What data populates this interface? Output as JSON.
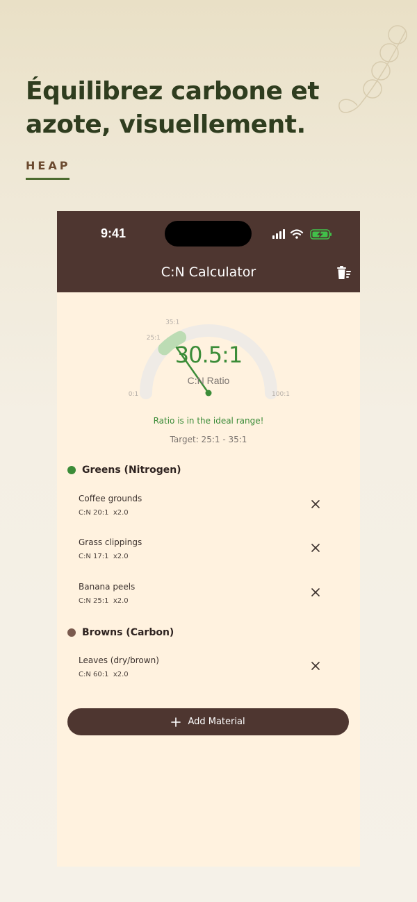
{
  "marketing": {
    "headline": "Équilibrez carbone et azote, visuellement.",
    "brand": "HEAP"
  },
  "status_bar": {
    "time": "9:41"
  },
  "nav": {
    "title": "C:N Calculator",
    "trash_icon": "trash-icon"
  },
  "gauge": {
    "ratio_value": 30.5,
    "ratio_display": "30.5:1",
    "min_label": "0:1",
    "max_label": "100:1",
    "ideal_start_label": "25:1",
    "ideal_end_label": "35:1",
    "min": 0,
    "max": 100,
    "ideal_min": 25,
    "ideal_max": 35,
    "caption": "C:N Ratio",
    "status_message": "Ratio is in the ideal range!",
    "target": "Target: 25:1 - 35:1"
  },
  "sections": {
    "greens": {
      "title": "Greens (Nitrogen)",
      "color": "#3b8c38",
      "items": [
        {
          "name": "Coffee grounds",
          "meta": "C:N 20:1  x2.0"
        },
        {
          "name": "Grass clippings",
          "meta": "C:N 17:1  x2.0"
        },
        {
          "name": "Banana peels",
          "meta": "C:N 25:1  x2.0"
        }
      ]
    },
    "browns": {
      "title": "Browns (Carbon)",
      "color": "#7a5a4e",
      "items": [
        {
          "name": "Leaves (dry/brown)",
          "meta": "C:N 60:1  x2.0"
        }
      ]
    }
  },
  "add_button": {
    "label": "Add Material"
  },
  "colors": {
    "accent_brown": "#4e3630",
    "accent_green": "#3b8c38",
    "background": "#fff2df"
  }
}
